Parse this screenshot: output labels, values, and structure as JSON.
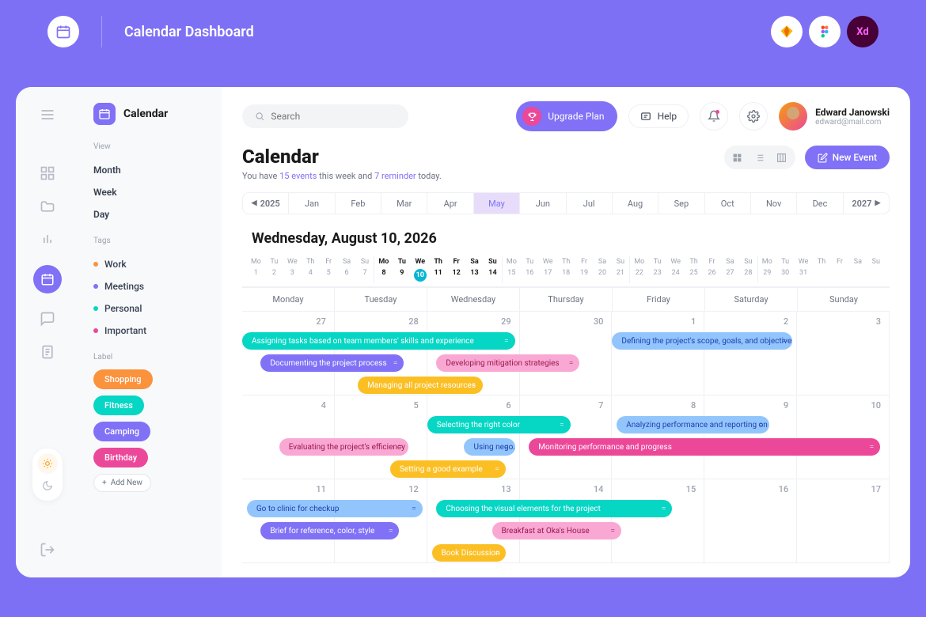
{
  "outer": {
    "title": "Calendar Dashboard"
  },
  "sidebar": {
    "app_name": "Calendar",
    "view_label": "View",
    "views": [
      "Month",
      "Week",
      "Day"
    ],
    "tags_label": "Tags",
    "tags": [
      {
        "label": "Work",
        "color": "#fb923c"
      },
      {
        "label": "Meetings",
        "color": "#8071f6"
      },
      {
        "label": "Personal",
        "color": "#06d6c4"
      },
      {
        "label": "Important",
        "color": "#ec4899"
      }
    ],
    "labels_label": "Label",
    "labels": [
      {
        "label": "Shopping",
        "color": "#fb923c"
      },
      {
        "label": "Fitness",
        "color": "#06d6c4"
      },
      {
        "label": "Camping",
        "color": "#8071f6"
      },
      {
        "label": "Birthday",
        "color": "#ec4899"
      }
    ],
    "add_new": "Add New"
  },
  "topbar": {
    "search_placeholder": "Search",
    "upgrade": "Upgrade Plan",
    "help": "Help",
    "user_name": "Edward Janowski",
    "user_email": "edward@mail.com"
  },
  "page": {
    "title": "Calendar",
    "sub_pre": "You have ",
    "sub_events": "15 events",
    "sub_mid": " this week and ",
    "sub_reminders": "7 reminder",
    "sub_post": " today.",
    "new_event": "New Event"
  },
  "timeline": {
    "year_prev": "2025",
    "year_next": "2027",
    "months": [
      "Jan",
      "Feb",
      "Mar",
      "Apr",
      "May",
      "Jun",
      "Jul",
      "Aug",
      "Sep",
      "Oct",
      "Nov",
      "Dec"
    ],
    "active_month_idx": 4,
    "date_heading": "Wednesday, August 10,  2026"
  },
  "dows": [
    "Monday",
    "Tuesday",
    "Wednesday",
    "Thursday",
    "Friday",
    "Saturday",
    "Sunday"
  ],
  "weeks": [
    {
      "days": [
        "27",
        "28",
        "29",
        "30",
        "1",
        "2",
        "3"
      ],
      "events": [
        [
          {
            "text": "Assigning tasks based on team members' skills and experience",
            "col": 0,
            "span": 3,
            "cls": "c-teal"
          },
          {
            "text": "Defining the project's scope, goals, and objectives",
            "col": 4,
            "span": 2,
            "cls": "c-blue"
          }
        ],
        [
          {
            "text": "Documenting the project process",
            "col": 0,
            "span": 1.6,
            "off": 0.2,
            "cls": "c-purple"
          },
          {
            "text": "Developing mitigation strategies",
            "col": 2,
            "span": 1.6,
            "off": 0.1,
            "cls": "c-pink"
          }
        ],
        [
          {
            "text": "Managing all project resources",
            "col": 1,
            "span": 1.4,
            "off": 0.25,
            "cls": "c-yellow"
          }
        ]
      ]
    },
    {
      "days": [
        "4",
        "5",
        "6",
        "7",
        "8",
        "9",
        "10"
      ],
      "events": [
        [
          {
            "text": "Selecting the right color",
            "col": 2,
            "span": 1.6,
            "cls": "c-teal"
          },
          {
            "text": "Analyzing performance and reporting on it",
            "col": 4,
            "span": 1.7,
            "off": 0.05,
            "cls": "c-blue"
          }
        ],
        [
          {
            "text": "Evaluating the project's efficiency",
            "col": 0,
            "span": 1.45,
            "off": 0.4,
            "cls": "c-pink"
          },
          {
            "text": "Using nego...",
            "col": 2,
            "span": 0.6,
            "off": 0.4,
            "cls": "c-blue"
          },
          {
            "text": "Monitoring performance and progress",
            "col": 3,
            "span": 3.85,
            "off": 0.1,
            "cls": "c-hotpink"
          }
        ],
        [
          {
            "text": "Setting a good example",
            "col": 1,
            "span": 1.3,
            "off": 0.6,
            "cls": "c-yellow"
          }
        ]
      ]
    },
    {
      "days": [
        "11",
        "12",
        "13",
        "14",
        "15",
        "16",
        "17"
      ],
      "events": [
        [
          {
            "text": "Go to clinic for checkup",
            "col": 0,
            "span": 1.95,
            "off": 0.05,
            "cls": "c-blue"
          },
          {
            "text": "Choosing the visual elements for the project",
            "col": 2,
            "span": 2.6,
            "off": 0.1,
            "cls": "c-teal"
          }
        ],
        [
          {
            "text": "Brief for reference, color, style",
            "col": 0,
            "span": 1.55,
            "off": 0.2,
            "cls": "c-purple"
          },
          {
            "text": "Breakfast at Oka's House",
            "col": 2,
            "span": 1.45,
            "off": 0.7,
            "cls": "c-pink"
          }
        ],
        [
          {
            "text": "Book Discussion",
            "col": 2,
            "span": 0.85,
            "off": 0.05,
            "cls": "c-yellow"
          }
        ]
      ]
    }
  ],
  "mini_dows": [
    "Mo",
    "Tu",
    "We",
    "Th",
    "Fr",
    "Sa",
    "Su"
  ],
  "mini_nums": [
    "1",
    "2",
    "3",
    "4",
    "5",
    "6",
    "7",
    "8",
    "9",
    "10",
    "11",
    "12",
    "13",
    "14",
    "15",
    "16",
    "17",
    "18",
    "19",
    "20",
    "21",
    "22",
    "23",
    "24",
    "25",
    "26",
    "27",
    "28",
    "29",
    "30",
    "31"
  ]
}
